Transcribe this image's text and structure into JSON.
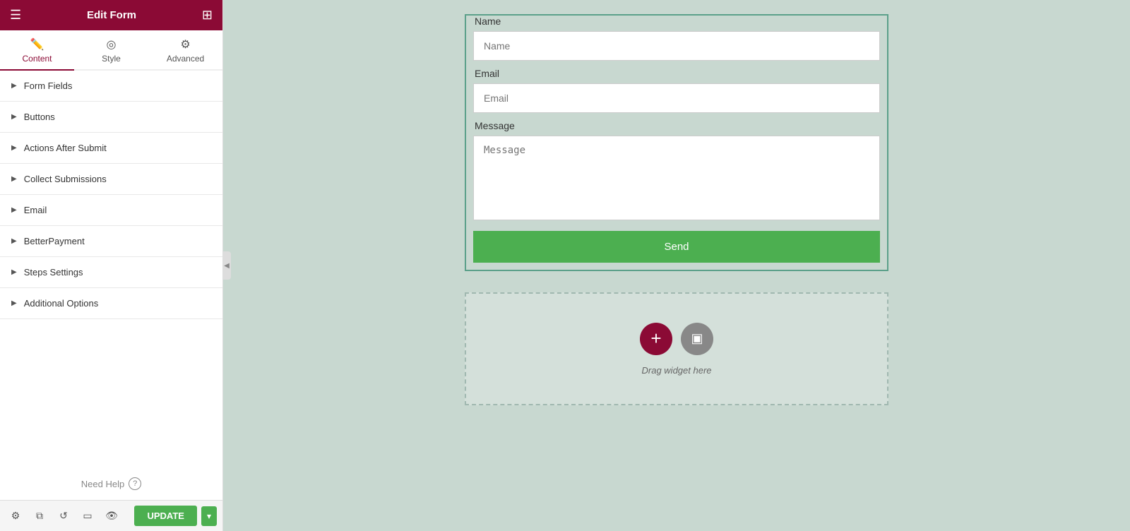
{
  "header": {
    "title": "Edit Form",
    "menu_icon": "☰",
    "grid_icon": "⊞"
  },
  "tabs": [
    {
      "id": "content",
      "label": "Content",
      "icon": "✏",
      "active": true
    },
    {
      "id": "style",
      "label": "Style",
      "icon": "◎",
      "active": false
    },
    {
      "id": "advanced",
      "label": "Advanced",
      "icon": "⚙",
      "active": false
    }
  ],
  "accordion": [
    {
      "id": "form-fields",
      "label": "Form Fields"
    },
    {
      "id": "buttons",
      "label": "Buttons"
    },
    {
      "id": "actions-after-submit",
      "label": "Actions After Submit"
    },
    {
      "id": "collect-submissions",
      "label": "Collect Submissions"
    },
    {
      "id": "email",
      "label": "Email"
    },
    {
      "id": "better-payment",
      "label": "BetterPayment"
    },
    {
      "id": "steps-settings",
      "label": "Steps Settings"
    },
    {
      "id": "additional-options",
      "label": "Additional Options"
    }
  ],
  "need_help": {
    "label": "Need Help",
    "icon": "?"
  },
  "toolbar": {
    "update_label": "UPDATE",
    "dropdown_icon": "▾"
  },
  "form": {
    "name_label": "Name",
    "name_placeholder": "Name",
    "email_label": "Email",
    "email_placeholder": "Email",
    "message_label": "Message",
    "message_placeholder": "Message",
    "send_label": "Send"
  },
  "drag_widget": {
    "label": "Drag widget here",
    "add_icon": "+",
    "widget_icon": "▣"
  }
}
